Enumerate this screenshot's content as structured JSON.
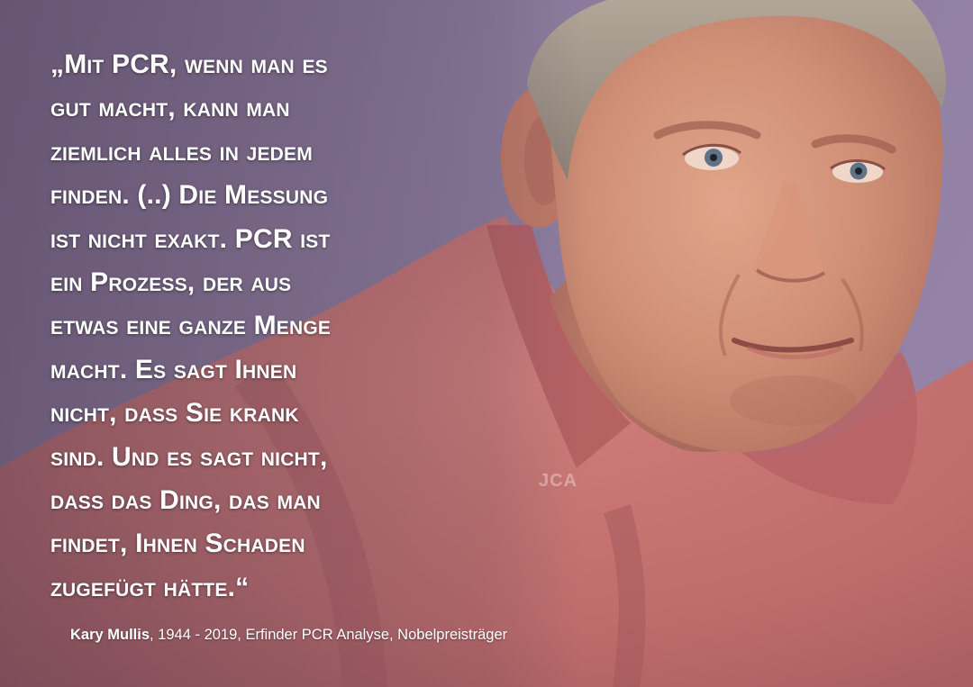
{
  "quote": {
    "lines": [
      "„Mit PCR, wenn man es",
      "gut macht, kann man",
      "ziemlich alles in jedem",
      "finden. (..) Die Messung",
      "ist nicht exakt. PCR ist",
      "ein Prozess, der aus",
      "etwas eine ganze Menge",
      "macht. Es sagt Ihnen",
      "nicht, dass Sie krank",
      "sind. Und es sagt nicht,",
      "dass das Ding, das man",
      "findet, Ihnen Schaden",
      "zugefügt hätte.“"
    ]
  },
  "watermark": "JCA",
  "credit": {
    "name": "Kary Mullis",
    "details": ", 1944 - 2019, Erfinder PCR Analyse, Nobelpreisträger"
  },
  "colors": {
    "background_purple": "#7d6a8c",
    "shirt": "#c2706e",
    "skin": "#cf8f78",
    "hair": "#9a8f84",
    "text": "#ffffff"
  }
}
